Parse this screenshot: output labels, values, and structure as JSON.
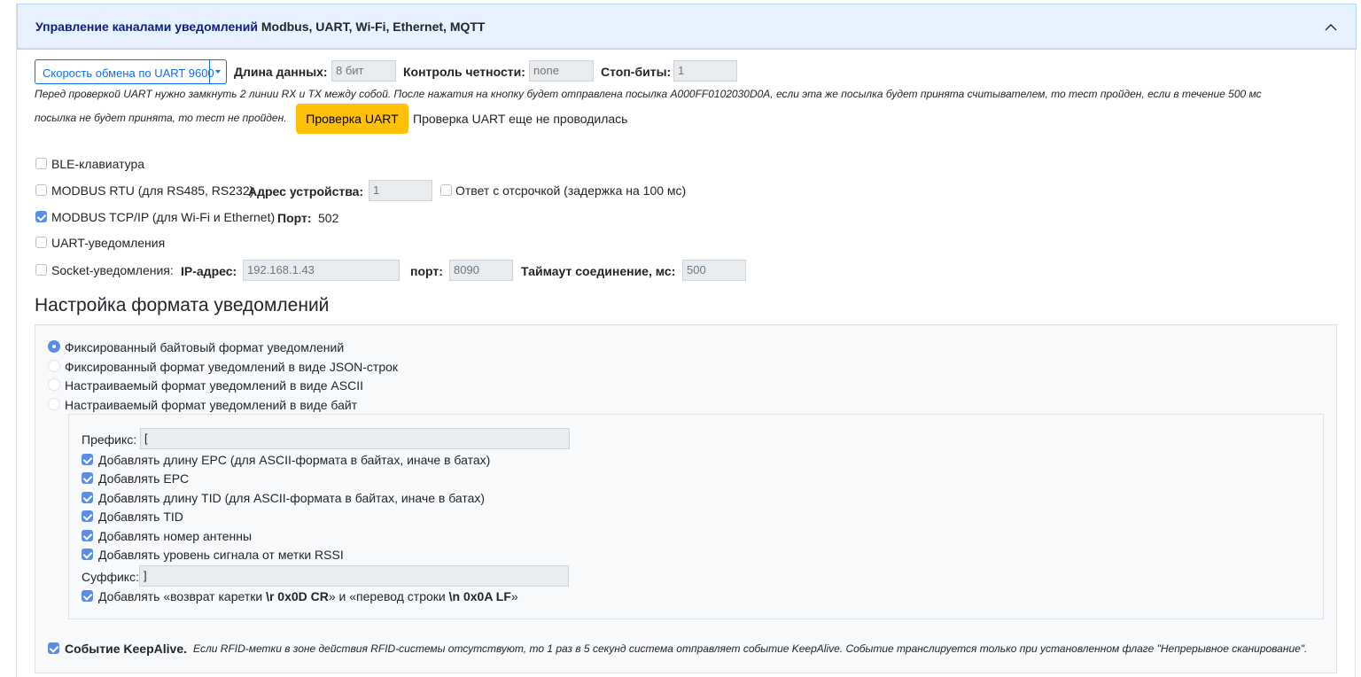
{
  "header": {
    "title_bold": "Управление каналами уведомлений",
    "title_rest": "Modbus, UART, Wi-Fi, Ethernet, MQTT"
  },
  "uart": {
    "speed_select": "Скорость обмена по UART 9600",
    "data_length_label": "Длина данных:",
    "data_length_value": "8 бит",
    "parity_label": "Контроль четности:",
    "parity_value": "none",
    "stop_bits_label": "Стоп-биты:",
    "stop_bits_value": "1",
    "note_line1": "Перед проверкой UART нужно замкнуть 2 линии RX и TX между собой. После нажатия на кнопку будет отправлена посылка A000FF0102030D0A, если эта же посылка будет принята считывателем, то тест пройден, если в течение 500 мс",
    "note_line2": "посылка не будет принята, то тест не пройден.",
    "test_button": "Проверка UART",
    "test_status": "Проверка UART еще не проводилась"
  },
  "channels": {
    "ble": {
      "label": "BLE-клавиатура",
      "checked": false
    },
    "modbus_rtu": {
      "label": "MODBUS RTU (для RS485, RS232)",
      "checked": false,
      "address_label": "Адрес устройства:",
      "address_value": "1",
      "delay_label": "Ответ с отсрочкой (задержка на 100 мс)",
      "delay_checked": false
    },
    "modbus_tcp": {
      "label": "MODBUS TCP/IP (для Wi-Fi и Ethernet)",
      "checked": true,
      "port_label": "Порт:",
      "port_value": "502"
    },
    "uart_notify": {
      "label": "UART-уведомления",
      "checked": false
    },
    "socket": {
      "label": "Socket-уведомления:",
      "checked": false,
      "ip_label": "IP-адрес:",
      "ip_value": "192.168.1.43",
      "port_label": "порт:",
      "port_value": "8090",
      "timeout_label": "Таймаут соединение, мс:",
      "timeout_value": "500"
    }
  },
  "format": {
    "heading": "Настройка формата уведомлений",
    "radios": [
      {
        "label": "Фиксированный байтовый формат уведомлений",
        "selected": true
      },
      {
        "label": "Фиксированный формат уведомлений в виде JSON-строк",
        "selected": false
      },
      {
        "label": "Настраиваемый формат уведомлений в виде ASCII",
        "selected": false
      },
      {
        "label": "Настраиваемый формат уведомлений в виде байт",
        "selected": false
      }
    ],
    "prefix_label": "Префикс:",
    "prefix_value": "[",
    "options": [
      {
        "label": "Добавлять длину EPC (для ASCII-формата в байтах, иначе в батах)",
        "checked": true
      },
      {
        "label": "Добавлять EPC",
        "checked": true
      },
      {
        "label": "Добавлять длину TID (для ASCII-формата в байтах, иначе в батах)",
        "checked": true
      },
      {
        "label": "Добавлять TID",
        "checked": true
      },
      {
        "label": "Добавлять номер антенны",
        "checked": true
      },
      {
        "label": "Добавлять уровень сигнала от метки RSSI",
        "checked": true
      }
    ],
    "suffix_label": "Суффикс:",
    "suffix_value": "]",
    "crlf": {
      "checked": true,
      "part1": "Добавлять «возврат каретки ",
      "part2": "\\r 0x0D CR",
      "part3": "» и «перевод строки ",
      "part4": "\\n 0x0A LF",
      "part5": "»"
    },
    "keepalive": {
      "checked": true,
      "label": "Событие KeepAlive.",
      "note": "Если RFID-метки в зоне действия RFID-системы отсутствуют, то 1 раз в 5 секунд система отправляет событие KeepAlive. Событие транслируется только при установленном флаге \"Непрерывное сканирование\"."
    }
  },
  "colors": {
    "header_bg": "#e7f1ff",
    "accent": "#0d6efd",
    "warning": "#ffc107",
    "checkbox_on": "#5b8de8"
  }
}
